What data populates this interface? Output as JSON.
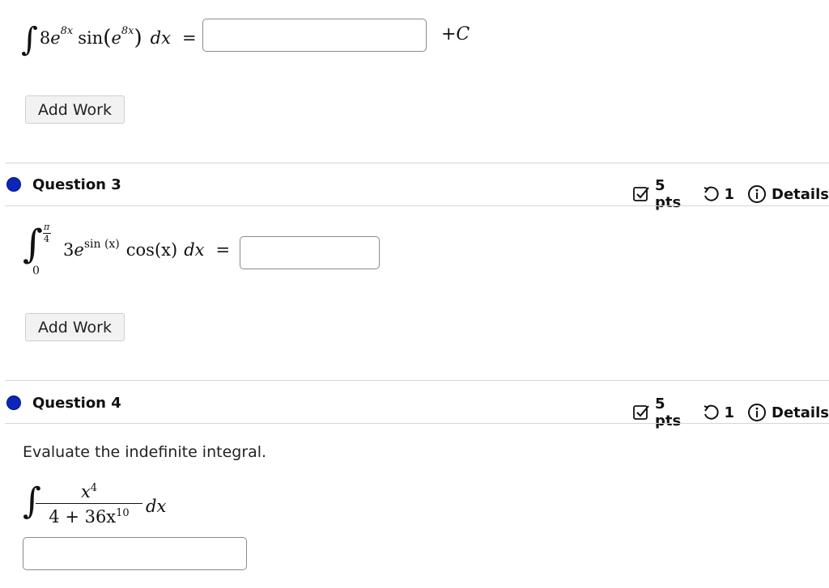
{
  "q2": {
    "integrand_coef": "8",
    "integrand_base": "e",
    "integrand_exp": "8x",
    "integrand_func": "sin",
    "integrand_inner_base": "e",
    "integrand_inner_exp": "8x",
    "dx": "dx",
    "equals": "=",
    "plus_c": "+C",
    "add_work_label": "Add Work"
  },
  "q3": {
    "title": "Question 3",
    "points": "5 pts",
    "retries": "1",
    "details_label": "Details",
    "upper_num": "π",
    "upper_den": "4",
    "lower": "0",
    "coef": "3",
    "base": "e",
    "exp": "sin (x)",
    "func": "cos(x)",
    "dx": "dx",
    "equals": "=",
    "add_work_label": "Add Work"
  },
  "q4": {
    "title": "Question 4",
    "points": "5 pts",
    "retries": "1",
    "details_label": "Details",
    "prompt": "Evaluate the indefinite integral.",
    "numerator": "x",
    "numerator_exp": "4",
    "denominator": "4 + 36x",
    "denominator_exp": "10",
    "dx": "dx"
  },
  "colors": {
    "question_dot": "#0b26b8",
    "divider": "#d6d6d6",
    "input_border": "#8a8a8a",
    "button_bg": "#f2f2f2"
  }
}
